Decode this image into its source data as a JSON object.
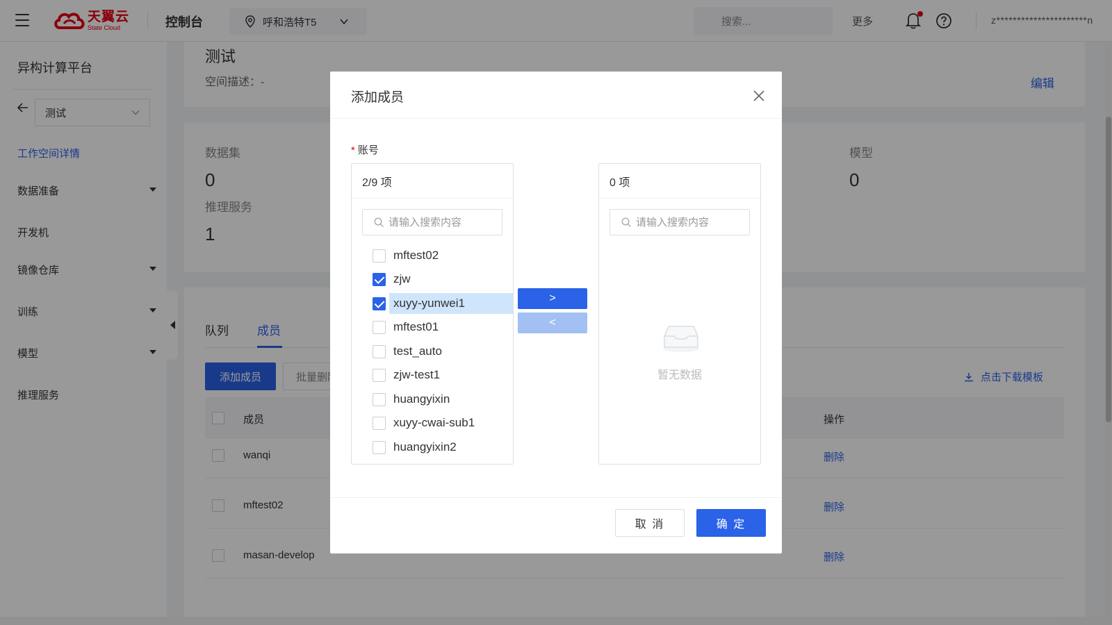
{
  "header": {
    "logo_cn": "天翼云",
    "logo_en": "State Cloud",
    "console": "控制台",
    "region": "呼和浩特T5",
    "search_placeholder": "搜索...",
    "more": "更多",
    "user": "z**********************n"
  },
  "sidebar": {
    "title": "异构计算平台",
    "workspace": "测试",
    "items": [
      {
        "label": "工作空间详情",
        "active": true
      },
      {
        "label": "数据准备",
        "expandable": true
      },
      {
        "label": "开发机"
      },
      {
        "label": "镜像仓库",
        "expandable": true
      },
      {
        "label": "训练",
        "expandable": true
      },
      {
        "label": "模型",
        "expandable": true
      },
      {
        "label": "推理服务"
      }
    ]
  },
  "workspace": {
    "title": "测试",
    "desc": "空间描述：-",
    "edit": "编辑"
  },
  "stats": {
    "dataset_label": "数据集",
    "dataset_value": "0",
    "inference_label": "推理服务",
    "inference_value": "1",
    "model_label": "模型",
    "model_value": "0"
  },
  "members": {
    "tabs": [
      "队列",
      "成员"
    ],
    "add_button": "添加成员",
    "batch_button": "批量删除",
    "download": "点击下载模板",
    "col_member": "成员",
    "col_action": "操作",
    "rows": [
      {
        "name": "wanqi",
        "action": "删除"
      },
      {
        "name": "mftest02",
        "action": "删除"
      },
      {
        "name": "masan-develop",
        "action": "删除"
      }
    ]
  },
  "modal": {
    "title": "添加成员",
    "field_required": "*",
    "field_label": "账号",
    "left_count": "2/9 项",
    "right_count": "0 项",
    "search_placeholder": "请输入搜索内容",
    "move_right": ">",
    "move_left": "<",
    "empty_text": "暂无数据",
    "cancel": "取 消",
    "ok": "确 定",
    "accounts": [
      {
        "name": "mftest02",
        "checked": false
      },
      {
        "name": "zjw",
        "checked": true
      },
      {
        "name": "xuyy-yunwei1",
        "checked": true,
        "highlighted": true
      },
      {
        "name": "mftest01",
        "checked": false
      },
      {
        "name": "test_auto",
        "checked": false
      },
      {
        "name": "zjw-test1",
        "checked": false
      },
      {
        "name": "huangyixin",
        "checked": false
      },
      {
        "name": "xuyy-cwai-sub1",
        "checked": false
      },
      {
        "name": "huangyixin2",
        "checked": false
      }
    ]
  }
}
